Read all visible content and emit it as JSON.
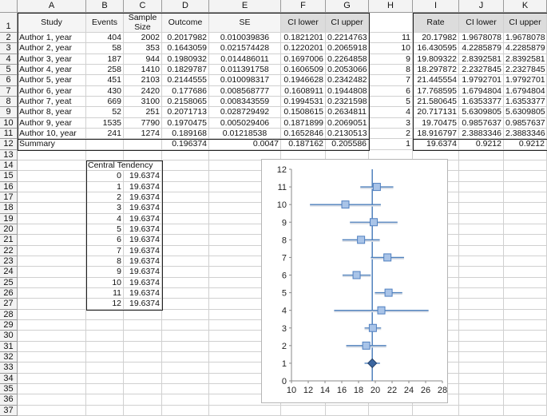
{
  "columns": [
    "A",
    "B",
    "C",
    "D",
    "E",
    "F",
    "G",
    "H",
    "I",
    "J",
    "K"
  ],
  "row_numbers": [
    "1",
    "2",
    "3",
    "4",
    "5",
    "6",
    "7",
    "8",
    "9",
    "10",
    "11",
    "12",
    "13",
    "14",
    "15",
    "16",
    "17",
    "18",
    "19",
    "20",
    "21",
    "22",
    "23",
    "24",
    "25",
    "26",
    "27",
    "28",
    "29",
    "30",
    "31",
    "32",
    "33",
    "34",
    "35",
    "36",
    "37"
  ],
  "headers": {
    "A": "Study",
    "B": "Events",
    "C": "Sample Size",
    "D": "Outcome",
    "E": "SE",
    "F": "CI lower",
    "G": "CI upper",
    "H": "",
    "I": "Rate",
    "J": "CI lower",
    "K": "CI upper"
  },
  "studies": [
    {
      "A": "Author 1, year",
      "B": "404",
      "C": "2002",
      "D": "0.2017982",
      "E": "0.010039836",
      "F": "0.1821201",
      "G": "0.2214763",
      "H": "11",
      "I": "20.17982",
      "J": "1.9678078",
      "K": "1.9678078"
    },
    {
      "A": "Author 2, year",
      "B": "58",
      "C": "353",
      "D": "0.1643059",
      "E": "0.021574428",
      "F": "0.1220201",
      "G": "0.2065918",
      "H": "10",
      "I": "16.430595",
      "J": "4.2285879",
      "K": "4.2285879"
    },
    {
      "A": "Author 3, year",
      "B": "187",
      "C": "944",
      "D": "0.1980932",
      "E": "0.014486011",
      "F": "0.1697006",
      "G": "0.2264858",
      "H": "9",
      "I": "19.809322",
      "J": "2.8392581",
      "K": "2.8392581"
    },
    {
      "A": "Author 4, year",
      "B": "258",
      "C": "1410",
      "D": "0.1829787",
      "E": "0.011391758",
      "F": "0.1606509",
      "G": "0.2053066",
      "H": "8",
      "I": "18.297872",
      "J": "2.2327845",
      "K": "2.2327845"
    },
    {
      "A": "Author 5, year",
      "B": "451",
      "C": "2103",
      "D": "0.2144555",
      "E": "0.010098317",
      "F": "0.1946628",
      "G": "0.2342482",
      "H": "7",
      "I": "21.445554",
      "J": "1.9792701",
      "K": "1.9792701"
    },
    {
      "A": "Author 6, year",
      "B": "430",
      "C": "2420",
      "D": "0.177686",
      "E": "0.008568777",
      "F": "0.1608911",
      "G": "0.1944808",
      "H": "6",
      "I": "17.768595",
      "J": "1.6794804",
      "K": "1.6794804"
    },
    {
      "A": "Author 7, yeat",
      "B": "669",
      "C": "3100",
      "D": "0.2158065",
      "E": "0.008343559",
      "F": "0.1994531",
      "G": "0.2321598",
      "H": "5",
      "I": "21.580645",
      "J": "1.6353377",
      "K": "1.6353377"
    },
    {
      "A": "Author 8, year",
      "B": "52",
      "C": "251",
      "D": "0.2071713",
      "E": "0.028729492",
      "F": "0.1508615",
      "G": "0.2634811",
      "H": "4",
      "I": "20.717131",
      "J": "5.6309805",
      "K": "5.6309805"
    },
    {
      "A": "Author 9, year",
      "B": "1535",
      "C": "7790",
      "D": "0.1970475",
      "E": "0.005029406",
      "F": "0.1871899",
      "G": "0.2069051",
      "H": "3",
      "I": "19.70475",
      "J": "0.9857637",
      "K": "0.9857637"
    },
    {
      "A": "Author 10, year",
      "B": "241",
      "C": "1274",
      "D": "0.189168",
      "E": "0.01218538",
      "F": "0.1652846",
      "G": "0.2130513",
      "H": "2",
      "I": "18.916797",
      "J": "2.3883346",
      "K": "2.3883346"
    },
    {
      "A": "Summary",
      "B": "",
      "C": "",
      "D": "0.196374",
      "E": "0.0047",
      "F": "0.187162",
      "G": "0.205586",
      "H": "1",
      "I": "19.6374",
      "J": "0.9212",
      "K": "0.9212"
    }
  ],
  "central_tendency": {
    "label": "Central Tendency",
    "rows": [
      {
        "y": "0",
        "x": "19.6374"
      },
      {
        "y": "1",
        "x": "19.6374"
      },
      {
        "y": "2",
        "x": "19.6374"
      },
      {
        "y": "3",
        "x": "19.6374"
      },
      {
        "y": "4",
        "x": "19.6374"
      },
      {
        "y": "5",
        "x": "19.6374"
      },
      {
        "y": "6",
        "x": "19.6374"
      },
      {
        "y": "7",
        "x": "19.6374"
      },
      {
        "y": "8",
        "x": "19.6374"
      },
      {
        "y": "9",
        "x": "19.6374"
      },
      {
        "y": "10",
        "x": "19.6374"
      },
      {
        "y": "11",
        "x": "19.6374"
      },
      {
        "y": "12",
        "x": "19.6374"
      }
    ]
  },
  "chart_data": {
    "type": "scatter",
    "xlim": [
      10,
      28
    ],
    "ylim": [
      0,
      12
    ],
    "x_ticks": [
      "10",
      "12",
      "14",
      "16",
      "18",
      "20",
      "22",
      "24",
      "26",
      "28"
    ],
    "y_ticks": [
      "0",
      "1",
      "2",
      "3",
      "4",
      "5",
      "6",
      "7",
      "8",
      "9",
      "10",
      "11",
      "12"
    ],
    "points": [
      {
        "x": 20.17982,
        "y": 11,
        "err": 1.9678078
      },
      {
        "x": 16.430595,
        "y": 10,
        "err": 4.2285879
      },
      {
        "x": 19.809322,
        "y": 9,
        "err": 2.8392581
      },
      {
        "x": 18.297872,
        "y": 8,
        "err": 2.2327845
      },
      {
        "x": 21.445554,
        "y": 7,
        "err": 1.9792701
      },
      {
        "x": 17.768595,
        "y": 6,
        "err": 1.6794804
      },
      {
        "x": 21.580645,
        "y": 5,
        "err": 1.6353377
      },
      {
        "x": 20.717131,
        "y": 4,
        "err": 5.6309805
      },
      {
        "x": 19.70475,
        "y": 3,
        "err": 0.9857637
      },
      {
        "x": 18.916797,
        "y": 2,
        "err": 2.3883346
      }
    ],
    "summary": {
      "x": 19.6374,
      "y": 1,
      "err": 0.9212
    },
    "central_line_x": 19.6374,
    "grid": false,
    "colors": {
      "marker_fill": "#a9c4e8",
      "marker_edge": "#4f7fc0",
      "line": "#4f81bd",
      "summary_fill": "#3b66a0"
    }
  }
}
